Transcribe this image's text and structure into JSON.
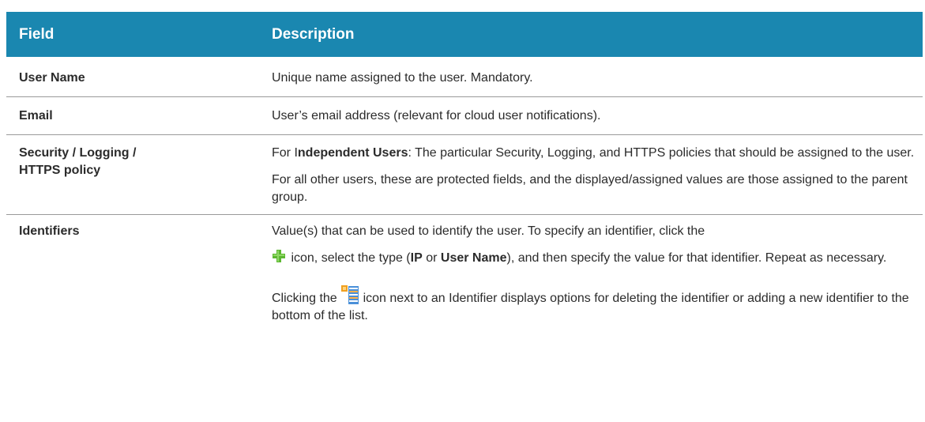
{
  "table": {
    "headers": {
      "field": "Field",
      "description": "Description"
    },
    "rows": {
      "user_name": {
        "field": "User Name",
        "description": "Unique name assigned to the user. Mandatory."
      },
      "email": {
        "field": "Email",
        "description": "User’s email address (relevant for cloud user notifications)."
      },
      "policy": {
        "field_line1": "Security / Logging /",
        "field_line2": "HTTPS policy",
        "p1_prefix": "For I",
        "p1_bold": "ndependent Users",
        "p1_suffix": ": The particular Security, Logging, and HTTPS policies that should be assigned to the user.",
        "p2": "For all other users, these are protected fields, and the displayed/assigned values are those assigned to the parent group."
      },
      "identifiers": {
        "field": "Identifiers",
        "p1": "Value(s) that can be used to identify the user. To specify an identifier, click the",
        "p2_icon": "plus-icon",
        "p2_a": " icon, select the type (",
        "p2_bold1": "IP",
        "p2_b": " or ",
        "p2_bold2": "User Name",
        "p2_c": "), and then specify the value for that identifier. Repeat as necessary.",
        "p3_a": "Clicking the ",
        "p3_icon": "list-menu-icon",
        "p3_b": " icon next to an Identifier displays options for deleting the identifier or adding a new identifier to the bottom of the list."
      }
    }
  },
  "colors": {
    "header_bg": "#1a87b0",
    "header_text": "#ffffff",
    "row_divider": "#9a9a9a",
    "plus_green": "#5db832",
    "menu_orange": "#f0a020",
    "menu_blue": "#4a90d9"
  }
}
